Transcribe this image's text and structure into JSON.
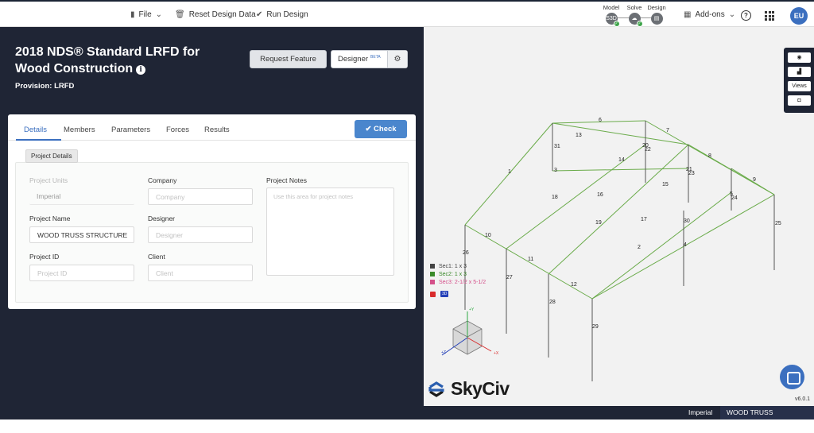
{
  "topbar": {
    "file": "File",
    "reset": "Reset Design Data",
    "run": "Run Design",
    "stages": [
      {
        "label": "Model",
        "icon": "S3D"
      },
      {
        "label": "Solve",
        "icon": "cloud-icon"
      },
      {
        "label": "Design",
        "icon": "document-icon"
      }
    ],
    "addons": "Add-ons",
    "avatar": "EU"
  },
  "header": {
    "title": "2018 NDS® Standard LRFD for Wood Construction",
    "provision": "Provision: LRFD",
    "request_feature": "Request Feature",
    "designer": "Designer",
    "designer_badge": "BETA"
  },
  "tabs": [
    "Details",
    "Members",
    "Parameters",
    "Forces",
    "Results"
  ],
  "check_button": "Check",
  "section_tag": "Project Details",
  "form": {
    "units_label": "Project Units",
    "units_value": "Imperial",
    "company_label": "Company",
    "company_placeholder": "Company",
    "notes_label": "Project Notes",
    "notes_placeholder": "Use this area for project notes",
    "name_label": "Project Name",
    "name_value": "WOOD TRUSS STRUCTURE",
    "designer_label": "Designer",
    "designer_placeholder": "Designer",
    "id_label": "Project ID",
    "id_placeholder": "Project ID",
    "client_label": "Client",
    "client_placeholder": "Client"
  },
  "viewport": {
    "toolbar": {
      "views": "Views"
    },
    "legend": [
      {
        "label": "Sec1: 1 x 3",
        "color": "#444444"
      },
      {
        "label": "Sec2: 1 x 3",
        "color": "#3a8a2a"
      },
      {
        "label": "Sec3: 2-1/2 x 5-1/2",
        "color": "#d4508a"
      }
    ],
    "badge_3d": "3D",
    "axes": {
      "y": "+Y",
      "x": "+X",
      "z": "+Z"
    },
    "member_labels": [
      "1",
      "2",
      "3",
      "4",
      "5",
      "6",
      "7",
      "8",
      "9",
      "10",
      "11",
      "12",
      "13",
      "14",
      "15",
      "16",
      "17",
      "18",
      "19",
      "20",
      "21",
      "22",
      "23",
      "24",
      "25",
      "26",
      "27",
      "28",
      "29",
      "30",
      "31"
    ],
    "logo": "SkyCiv",
    "version": "v6.0.1"
  },
  "statusbar": {
    "units": "Imperial",
    "file": "WOOD TRUSS STRUCTURE*"
  }
}
